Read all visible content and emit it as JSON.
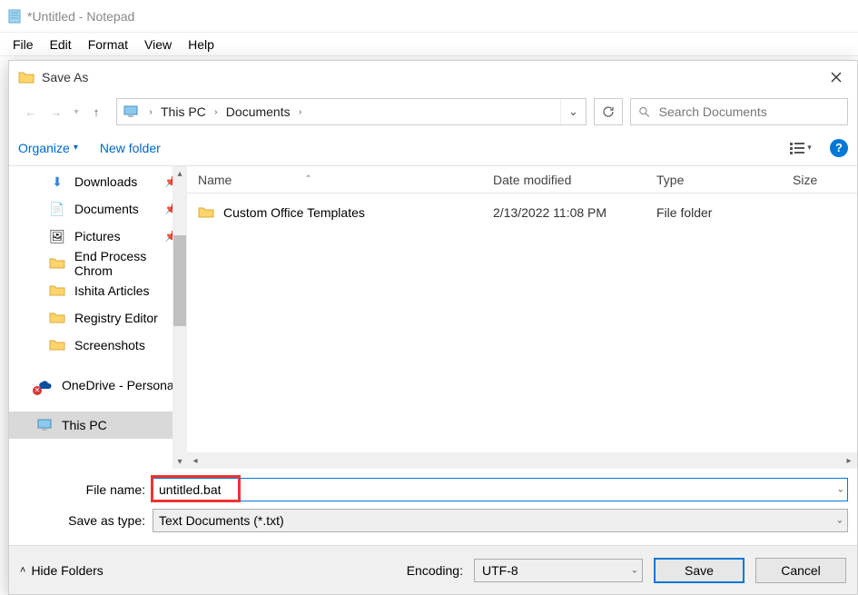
{
  "notepad": {
    "title": "*Untitled - Notepad",
    "menu": {
      "file": "File",
      "edit": "Edit",
      "format": "Format",
      "view": "View",
      "help": "Help"
    }
  },
  "dialog": {
    "title": "Save As",
    "breadcrumb": {
      "seg1": "This PC",
      "seg2": "Documents"
    },
    "search_placeholder": "Search Documents",
    "toolbar": {
      "organize": "Organize",
      "newfolder": "New folder"
    },
    "tree": {
      "downloads": "Downloads",
      "documents": "Documents",
      "pictures": "Pictures",
      "endprocess": "End Process Chrom",
      "ishita": "Ishita Articles",
      "registry": "Registry Editor",
      "screenshots": "Screenshots",
      "onedrive": "OneDrive - Personal",
      "thispc": "This PC"
    },
    "headers": {
      "name": "Name",
      "date": "Date modified",
      "type": "Type",
      "size": "Size"
    },
    "rows": [
      {
        "name": "Custom Office Templates",
        "date": "2/13/2022 11:08 PM",
        "type": "File folder",
        "size": ""
      }
    ],
    "form": {
      "filename_label": "File name:",
      "filename_value": "untitled.bat",
      "type_label": "Save as type:",
      "type_value": "Text Documents (*.txt)"
    },
    "footer": {
      "hide": "Hide Folders",
      "encoding_label": "Encoding:",
      "encoding_value": "UTF-8",
      "save": "Save",
      "cancel": "Cancel"
    }
  }
}
